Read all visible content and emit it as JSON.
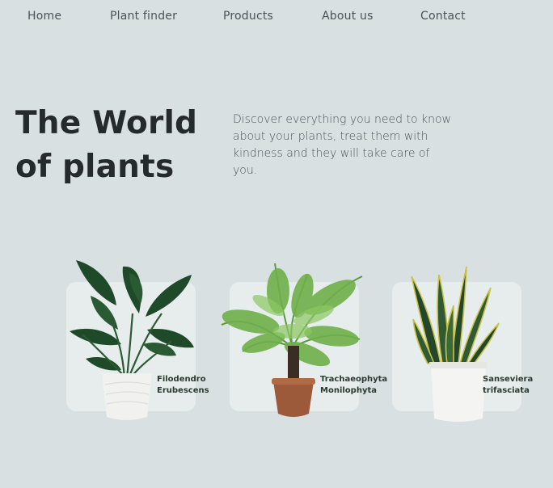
{
  "nav": {
    "items": [
      {
        "label": "Home"
      },
      {
        "label": "Plant finder"
      },
      {
        "label": "Products"
      },
      {
        "label": "About us"
      },
      {
        "label": "Contact"
      }
    ]
  },
  "hero": {
    "title": "The World of plants",
    "description": "Discover everything you need to know about your plants, treat them with kindness and they will take care of you."
  },
  "plants": [
    {
      "name_line1": "Filodendro",
      "name_line2": "Erubescens",
      "icon": "philodendron-plant-icon"
    },
    {
      "name_line1": "Trachaeophyta",
      "name_line2": "Monilophyta",
      "icon": "fern-plant-icon"
    },
    {
      "name_line1": "Sanseviera",
      "name_line2": "trifasciata",
      "icon": "snake-plant-icon"
    }
  ],
  "colors": {
    "background": "#d9e0e2",
    "card": "#e7eced",
    "title": "#252b2d",
    "leaf_dark": "#1f4a2a",
    "leaf_fern": "#5a9a3c",
    "pot_terracotta": "#9c5a3a"
  }
}
